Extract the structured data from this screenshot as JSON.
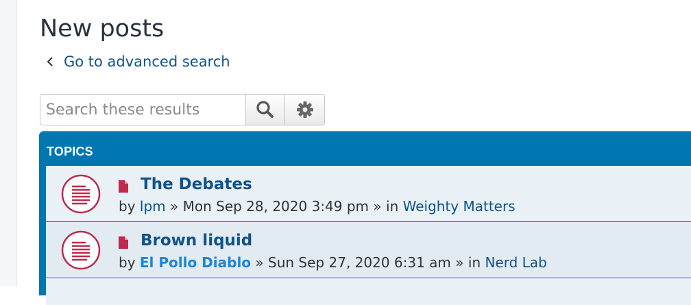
{
  "page": {
    "title": "New posts",
    "back_link": "Go to advanced search"
  },
  "search": {
    "placeholder": "Search these results"
  },
  "icons": {
    "back": "chevron-left-icon",
    "search": "search-icon",
    "settings": "gear-icon",
    "topic": "topic-read-icon",
    "post_file": "file-icon"
  },
  "colors": {
    "link": "#105289",
    "header_bg": "#0076b1",
    "topic_icon": "#bc2a4d",
    "highlight_author": "#1c86d8"
  },
  "topics": {
    "header": "TOPICS",
    "items": [
      {
        "title": "The Debates",
        "by": "by",
        "author": "lpm",
        "sep1": "»",
        "date": "Mon Sep 28, 2020 3:49 pm",
        "sep2": "»",
        "in": "in",
        "forum": "Weighty Matters"
      },
      {
        "title": "Brown liquid",
        "by": "by",
        "author": "El Pollo Diablo",
        "sep1": "»",
        "date": "Sun Sep 27, 2020 6:31 am",
        "sep2": "»",
        "in": "in",
        "forum": "Nerd Lab"
      }
    ]
  }
}
